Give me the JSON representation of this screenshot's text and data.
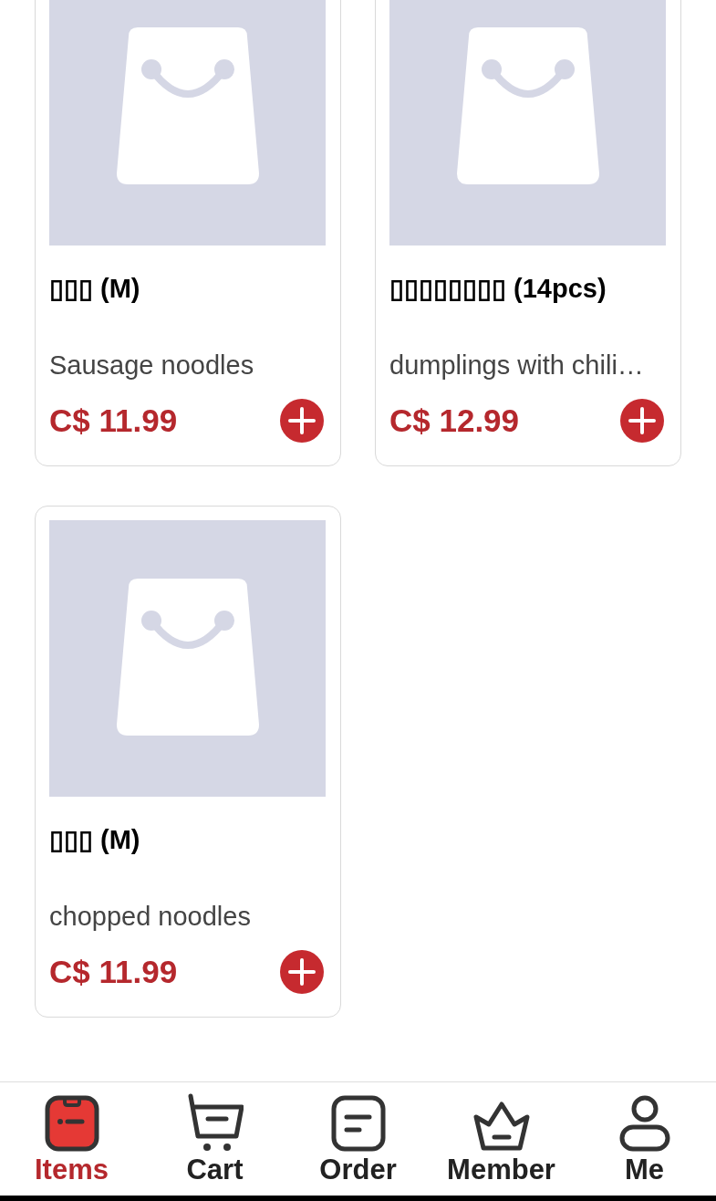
{
  "products": [
    {
      "title": "▯▯▯ (M)",
      "description": "Sausage noodles",
      "price": "C$ 11.99"
    },
    {
      "title": "▯▯▯▯▯▯▯▯ (14pcs)",
      "description": "dumplings with chili…",
      "price": "C$ 12.99"
    },
    {
      "title": "▯▯▯ (M)",
      "description": "chopped noodles",
      "price": "C$ 11.99"
    }
  ],
  "tab_bar": [
    {
      "kind": "items",
      "label": "Items",
      "selected": true
    },
    {
      "kind": "cart",
      "label": "Cart",
      "selected": false
    },
    {
      "kind": "order",
      "label": "Order",
      "selected": false
    },
    {
      "kind": "member",
      "label": "Member",
      "selected": false
    },
    {
      "kind": "me",
      "label": "Me",
      "selected": false
    }
  ]
}
